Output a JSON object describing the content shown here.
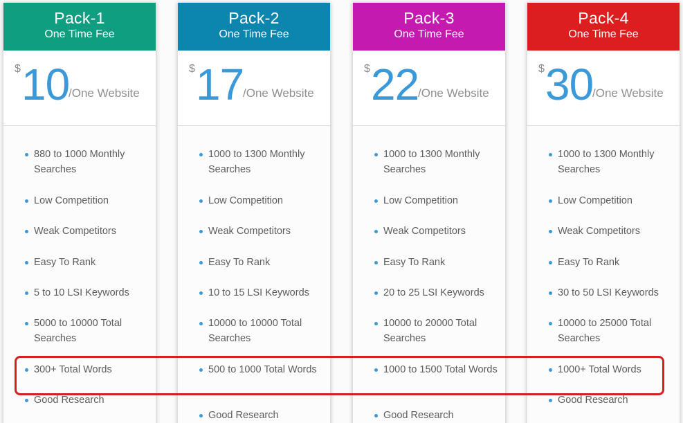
{
  "currency_symbol": "$",
  "unit_label": "/One Website",
  "colors": {
    "pack1": "#109e80",
    "pack2": "#0c86ad",
    "pack3": "#c41ab0",
    "pack4": "#dd1e1e",
    "price_accent": "#3a9ad9",
    "highlight": "#d42020"
  },
  "packs": [
    {
      "name": "Pack-1",
      "fee": "One Time Fee",
      "price": "10",
      "features": [
        "880 to 1000 Monthly Searches",
        "Low Competition",
        "Weak Competitors",
        "Easy To Rank",
        "5 to 10 LSI Keywords",
        "5000 to 10000 Total Searches",
        "300+ Total Words",
        "Good Research"
      ]
    },
    {
      "name": "Pack-2",
      "fee": "One Time Fee",
      "price": "17",
      "features": [
        "1000 to 1300 Monthly Searches",
        "Low Competition",
        "Weak Competitors",
        "Easy To Rank",
        "10 to 15 LSI Keywords",
        "10000 to 10000 Total Searches",
        "500 to 1000 Total Words",
        "Good Research"
      ]
    },
    {
      "name": "Pack-3",
      "fee": "One Time Fee",
      "price": "22",
      "features": [
        "1000 to 1300 Monthly Searches",
        "Low Competition",
        "Weak Competitors",
        "Easy To Rank",
        "20 to 25 LSI Keywords",
        "10000 to 20000 Total Searches",
        "1000 to 1500 Total Words",
        "Good Research"
      ]
    },
    {
      "name": "Pack-4",
      "fee": "One Time Fee",
      "price": "30",
      "features": [
        "1000 to 1300 Monthly Searches",
        "Low Competition",
        "Weak Competitors",
        "Easy To Rank",
        "30 to 50 LSI Keywords",
        "10000 to 25000 Total Searches",
        "1000+ Total Words",
        "Good Research"
      ]
    }
  ]
}
